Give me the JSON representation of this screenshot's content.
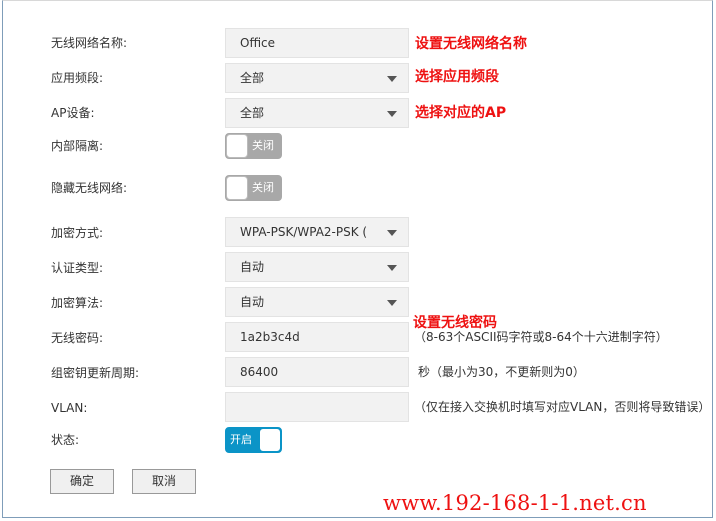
{
  "form": {
    "ssid": {
      "label": "无线网络名称:",
      "value": "Office",
      "annotation": "设置无线网络名称"
    },
    "band": {
      "label": "应用频段:",
      "value": "全部",
      "annotation": "选择应用频段"
    },
    "ap_device": {
      "label": "AP设备:",
      "value": "全部",
      "annotation": "选择对应的AP"
    },
    "isolation": {
      "label": "内部隔离:",
      "state": "关闭",
      "on": false
    },
    "hide_ssid": {
      "label": "隐藏无线网络:",
      "state": "关闭",
      "on": false
    },
    "encryption": {
      "label": "加密方式:",
      "value": "WPA-PSK/WPA2-PSK ("
    },
    "auth_type": {
      "label": "认证类型:",
      "value": "自动"
    },
    "cipher": {
      "label": "加密算法:",
      "value": "自动"
    },
    "password": {
      "label": "无线密码:",
      "value": "1a2b3c4d",
      "annotation": "设置无线密码",
      "hint": "（8-63个ASCII码字符或8-64个十六进制字符）"
    },
    "group_key": {
      "label": "组密钥更新周期:",
      "value": "86400",
      "hint": "秒（最小为30，不更新则为0）"
    },
    "vlan": {
      "label": "VLAN:",
      "value": "",
      "hint": "（仅在接入交换机时填写对应VLAN，否则将导致错误）"
    },
    "status": {
      "label": "状态:",
      "state": "开启",
      "on": true
    }
  },
  "buttons": {
    "ok": "确定",
    "cancel": "取消"
  },
  "watermark": "www.192-168-1-1.net.cn",
  "colors": {
    "annotation": "#ee1111",
    "toggle_on": "#0b94c7",
    "toggle_off": "#a8a8a8"
  }
}
